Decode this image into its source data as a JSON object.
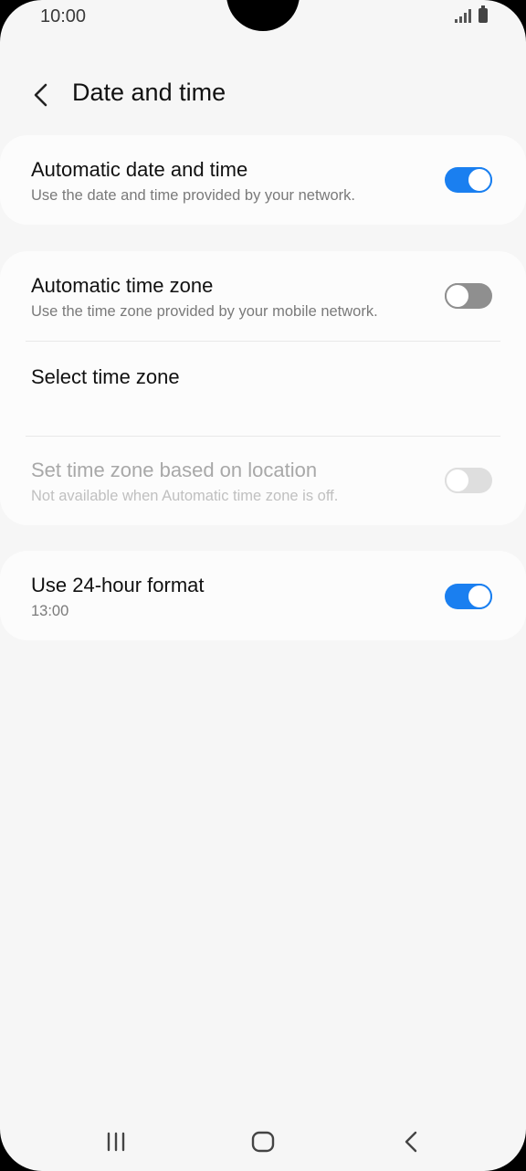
{
  "status_bar": {
    "time": "10:00",
    "icons": [
      "signal-icon",
      "battery-icon"
    ]
  },
  "header": {
    "title": "Date and time",
    "back_icon": "chevron-left-icon"
  },
  "settings": {
    "auto_date_time": {
      "title": "Automatic date and time",
      "subtitle": "Use the date and time provided by your network.",
      "enabled": true
    },
    "auto_time_zone": {
      "title": "Automatic time zone",
      "subtitle": "Use the time zone provided by your mobile network.",
      "enabled": false
    },
    "select_time_zone": {
      "title": "Select time zone"
    },
    "location_time_zone": {
      "title": "Set time zone based on location",
      "subtitle": "Not available when Automatic time zone is off.",
      "enabled": false,
      "disabled": true
    },
    "use_24_hour": {
      "title": "Use 24-hour format",
      "subtitle": "13:00",
      "enabled": true
    }
  },
  "colors": {
    "accent": "#1a7ff0",
    "background": "#f6f6f6",
    "card": "#fcfcfc",
    "toggle_off": "#8f8f8f",
    "toggle_disabled": "#dedede"
  },
  "nav_bar": {
    "icons": [
      "recent-apps-icon",
      "home-icon",
      "back-icon"
    ]
  }
}
